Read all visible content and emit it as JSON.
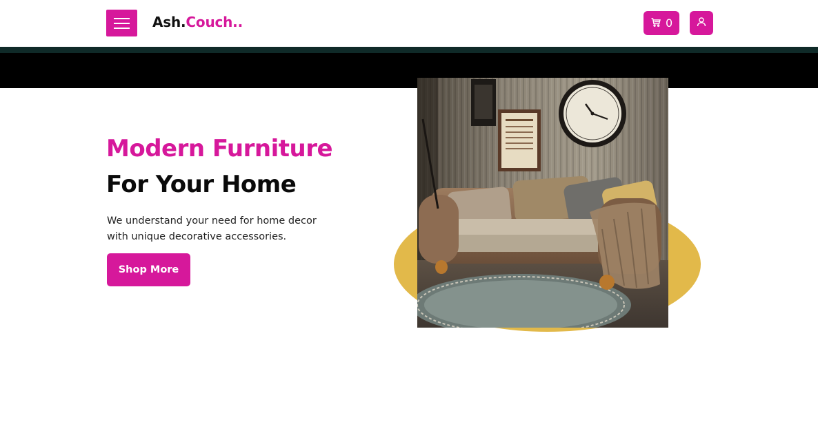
{
  "header": {
    "brand_primary": "Ash.",
    "brand_accent": "Couch..",
    "cart_count": "0"
  },
  "hero": {
    "title_line1": "Modern Furniture",
    "title_line2": "For Your Home",
    "description": "We understand your need for home decor with unique decorative accessories.",
    "cta_label": "Shop More"
  },
  "icons": {
    "menu": "hamburger-menu-icon",
    "cart": "shopping-cart-icon",
    "user": "user-icon"
  },
  "colors": {
    "accent": "#d6189b",
    "ellipse": "#e2b94a",
    "band": "#000000"
  }
}
